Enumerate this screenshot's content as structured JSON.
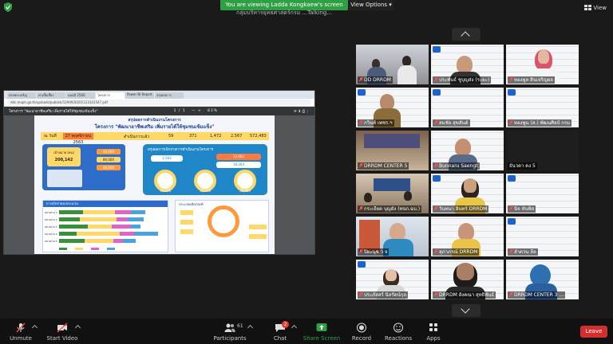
{
  "topbar": {
    "banner": "You are viewing Ladda Kongkaew's screen",
    "view_options": "View Options",
    "view_options_caret": "▾",
    "talking": "กลุ่มบริหารยุทธศาสตร์กรม ...Talking...",
    "view": "View"
  },
  "shared_screen": {
    "browser": {
      "tabs": [
        "ทรงพระเจริญ",
        "ค่าเบี้ยเลี้ยง",
        "แผนปี 2566",
        "โครงการ",
        "Power BI Report",
        "สรุปผลการ"
      ],
      "url": "ddc.moph.go.th/uploads/publish/1294920201123101547.pdf"
    },
    "pdf_toolbar": {
      "title": "โครงการ \"พัฒนาอาชีพเสริม เพิ่มรายได้ให้ชุมชนเข้มแข็ง\"",
      "page": "1 / 1",
      "zoom": "83%",
      "controls": "—  +"
    },
    "poster": {
      "title1": "สรุปผลการดำเนินงานโครงการ",
      "title2": "โครงการ \"พัฒนาอาชีพเสริม เพิ่มรายได้ให้ชุมชนเข้มแข็ง\"",
      "date_label": "ณ วันที่",
      "date_value": "27 พฤศจิกายน 2563",
      "stat_label": "ดำเนินการแล้ว",
      "stats": [
        "59",
        "371",
        "1,472",
        "2,567",
        "572,483"
      ],
      "left_box_title": "เป้าหมาย (คน)",
      "left_box_value": "200,142",
      "left_box_pills": [
        "40,000",
        "80,000",
        "40,000"
      ],
      "mid_box_title": "สรุปผลการเบิกจ่ายการดำเนินงานโครงการ",
      "mid_box_pills": [
        "2,563",
        "12,982",
        "18,264"
      ],
      "mid_circles": [
        "10,200",
        "12,340",
        "38,400"
      ],
      "bars_title": "การเบิกจ่ายงบประมาณ",
      "bar_rows": [
        "หน่วยงาน 1",
        "หน่วยงาน 2",
        "หน่วยงาน 3",
        "หน่วยงาน 4",
        "หน่วยงาน 5",
        "หน่วยงาน 6"
      ],
      "right_box_title": "ประเภทผลิตภัณฑ์",
      "right_values": [
        "27",
        "45",
        "1,230",
        "25,382",
        "1,140"
      ]
    }
  },
  "participants": [
    {
      "name": "DD DRRDM"
    },
    {
      "name": "ประพันธ์ ชูบุญส่ง (ระยะ)"
    },
    {
      "name": "ทองพูล สินเจริญผล"
    },
    {
      "name": "กวินท์ เพชร.ฯ"
    },
    {
      "name": "สมชัย สุขสันต์"
    },
    {
      "name": "ทองพูน (ส.) พัฒนศิลป์ กรม"
    },
    {
      "name": "DRRDM CENTER 5"
    },
    {
      "name": "Bunnaru Saengt"
    },
    {
      "name": "ธันวดา ดง 5"
    },
    {
      "name": "กระเจียด บุญยัง (ทจภ.ฉบ.)"
    },
    {
      "name": "วันทนา อินทร์ DRRDM"
    },
    {
      "name": "นิจ หันพิส"
    },
    {
      "name": "ปิยะนุช ว จ"
    },
    {
      "name": "สุภาภรณ์ DRRDM"
    },
    {
      "name": "ลำดวน ลีล"
    },
    {
      "name": "ประภัสสร์ นิลรัตน์กุล"
    },
    {
      "name": "DRRDM อังคณา สุทธิพันธ์"
    },
    {
      "name": "DRRDM CENTER 3 ..."
    }
  ],
  "bottombar": {
    "unmute": "Unmute",
    "start_video": "Start Video",
    "participants": "Participants",
    "participants_count": "61",
    "chat": "Chat",
    "chat_badge": "2",
    "share_screen": "Share Screen",
    "record": "Record",
    "reactions": "Reactions",
    "apps": "Apps",
    "leave": "Leave"
  },
  "colors": {
    "banner_green": "#2ea043",
    "leave_red": "#d32f2f",
    "muted_red": "#ff4d4d",
    "share_green": "#2ea043"
  }
}
